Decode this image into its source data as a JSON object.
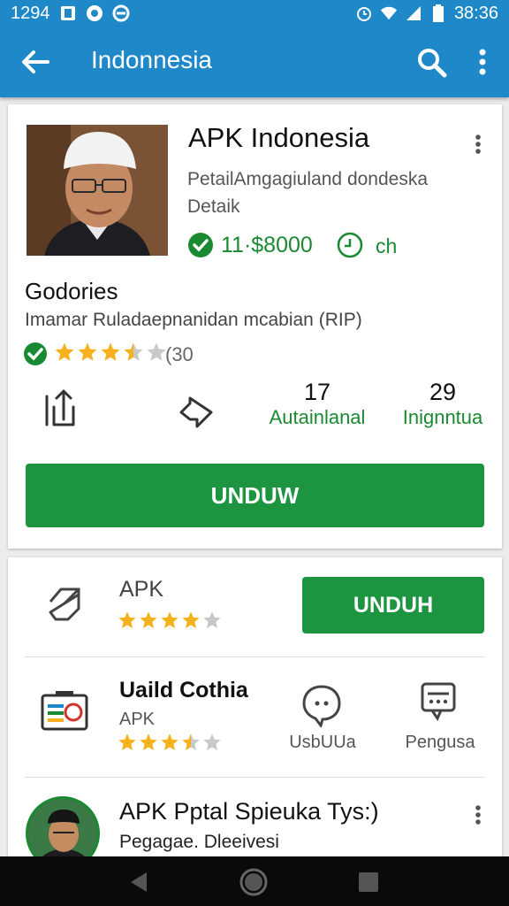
{
  "status": {
    "time_left": "1294",
    "time_right": "38:36"
  },
  "appbar": {
    "title": "Indonnesia"
  },
  "app": {
    "name": "APK Indonesia",
    "desc_line1": "PetailAmgagiuland dondeska",
    "desc_line2": "Detaik",
    "price": "11·$8000",
    "badge": "ch",
    "category": "Godories",
    "subtitle": "Imamar Ruladaepnanidan mcabian (RIP)",
    "rating_count": "(30",
    "rating": 3.5,
    "stat1_value": "17",
    "stat1_label": "Autainlanal",
    "stat2_value": "29",
    "stat2_label": "Inignntua",
    "download_label": "UNDUW"
  },
  "list": [
    {
      "title": "APK",
      "rating": 4,
      "button": "UNDUH"
    },
    {
      "title": "Uaild Cothia",
      "subtitle": "APK",
      "rating": 3.5,
      "action1": "UsbUUa",
      "action2": "Pengusa"
    },
    {
      "title": "APK Pptal Spieuka Tys:)",
      "subtitle": "Pegagae. Dleeivesi"
    }
  ],
  "colors": {
    "appbar": "#1f88c9",
    "accent_green": "#1c9440",
    "star": "#f5b21d"
  }
}
